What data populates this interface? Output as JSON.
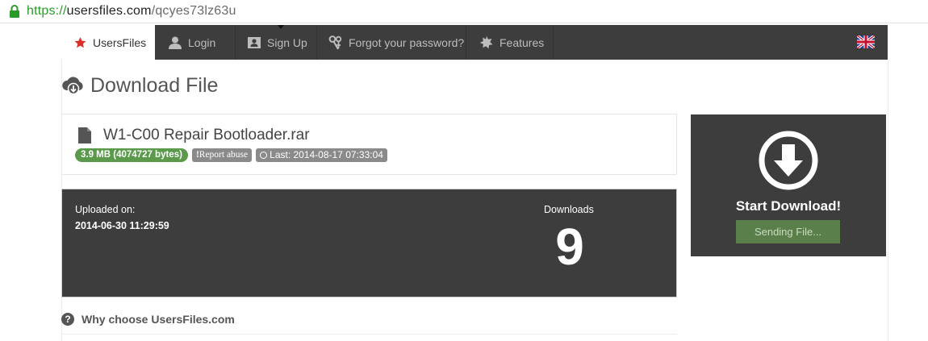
{
  "address_bar": {
    "scheme": "https://",
    "host": "usersfiles.com",
    "path": "/qcyes73lz63u"
  },
  "nav": {
    "items": [
      {
        "label": "UsersFiles",
        "icon": "star-icon",
        "active": true
      },
      {
        "label": "Login",
        "icon": "user-icon"
      },
      {
        "label": "Sign Up",
        "icon": "id-card-icon"
      },
      {
        "label": "Forgot your password?",
        "icon": "keys-icon"
      },
      {
        "label": "Features",
        "icon": "gear-star-icon"
      }
    ],
    "language_icon": "uk-flag-icon"
  },
  "page": {
    "title": "Download File"
  },
  "file": {
    "name": "W1-C00 Repair Bootloader.rar",
    "size_badge": "3.9 MB (4074727 bytes)",
    "report_badge": "Report abuse",
    "last_badge": "Last: 2014-08-17 07:33:04"
  },
  "info": {
    "uploaded_label": "Uploaded on:",
    "uploaded_value": "2014-06-30 11:29:59",
    "downloads_label": "Downloads",
    "downloads_count": "9"
  },
  "download_box": {
    "start_label": "Start Download!",
    "sending_label": "Sending File..."
  },
  "why": {
    "label": "Why choose UsersFiles.com"
  },
  "colors": {
    "navbar": "#3d3d3d",
    "star_red": "#d9302b",
    "badge_green": "#5a9a4a",
    "sending_green": "#5b7f4b"
  }
}
